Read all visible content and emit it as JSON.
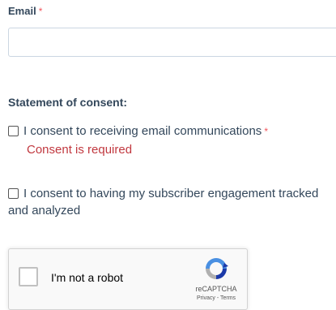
{
  "email": {
    "label": "Email",
    "required_mark": "*",
    "value": "",
    "placeholder": ""
  },
  "consent": {
    "heading": "Statement of consent:",
    "email_communications": {
      "label": "I consent to receiving email communications",
      "required_mark": "*",
      "checked": false,
      "error": "Consent is required"
    },
    "engagement_tracking": {
      "label": "I consent to having my subscriber engagement tracked and analyzed",
      "checked": false
    }
  },
  "recaptcha": {
    "label": "I'm not a robot",
    "brand": "reCAPTCHA",
    "privacy": "Privacy",
    "separator": " - ",
    "terms": "Terms",
    "logo_icon": "recaptcha-logo-icon"
  },
  "colors": {
    "text": "#33475b",
    "required": "#f2545b",
    "error": "#c1383f"
  }
}
